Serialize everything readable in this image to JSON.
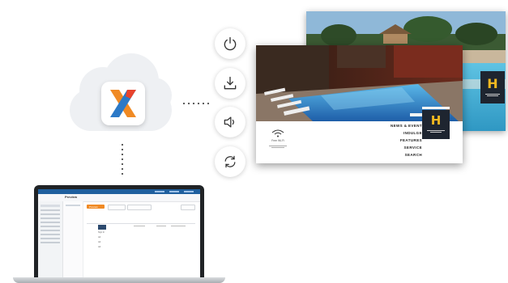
{
  "colors": {
    "accent_orange": "#f08a24",
    "brand_gold": "#f2b820",
    "cms_blue": "#2b79c7",
    "laptop_frame": "#202326"
  },
  "cloud": {
    "logo_icon": "x-logo-icon"
  },
  "controls": [
    {
      "name": "power-button",
      "icon": "power-icon"
    },
    {
      "name": "download-button",
      "icon": "download-icon"
    },
    {
      "name": "volume-button",
      "icon": "volume-icon"
    },
    {
      "name": "refresh-button",
      "icon": "refresh-icon"
    }
  ],
  "front_screen": {
    "menu": [
      "NEWS & EVENT",
      "INDULGE",
      "FEATURES",
      "SERVICE",
      "SEARCH"
    ],
    "brand_mark": "H",
    "wifi_caption": "Free Wi-Fi"
  },
  "back_screen": {
    "brand_mark": "H"
  },
  "laptop": {
    "app_title": "Preview",
    "active_button": "Preview",
    "list_items": [
      "Sign In",
      "Ad",
      "Ad",
      "Ad"
    ]
  }
}
